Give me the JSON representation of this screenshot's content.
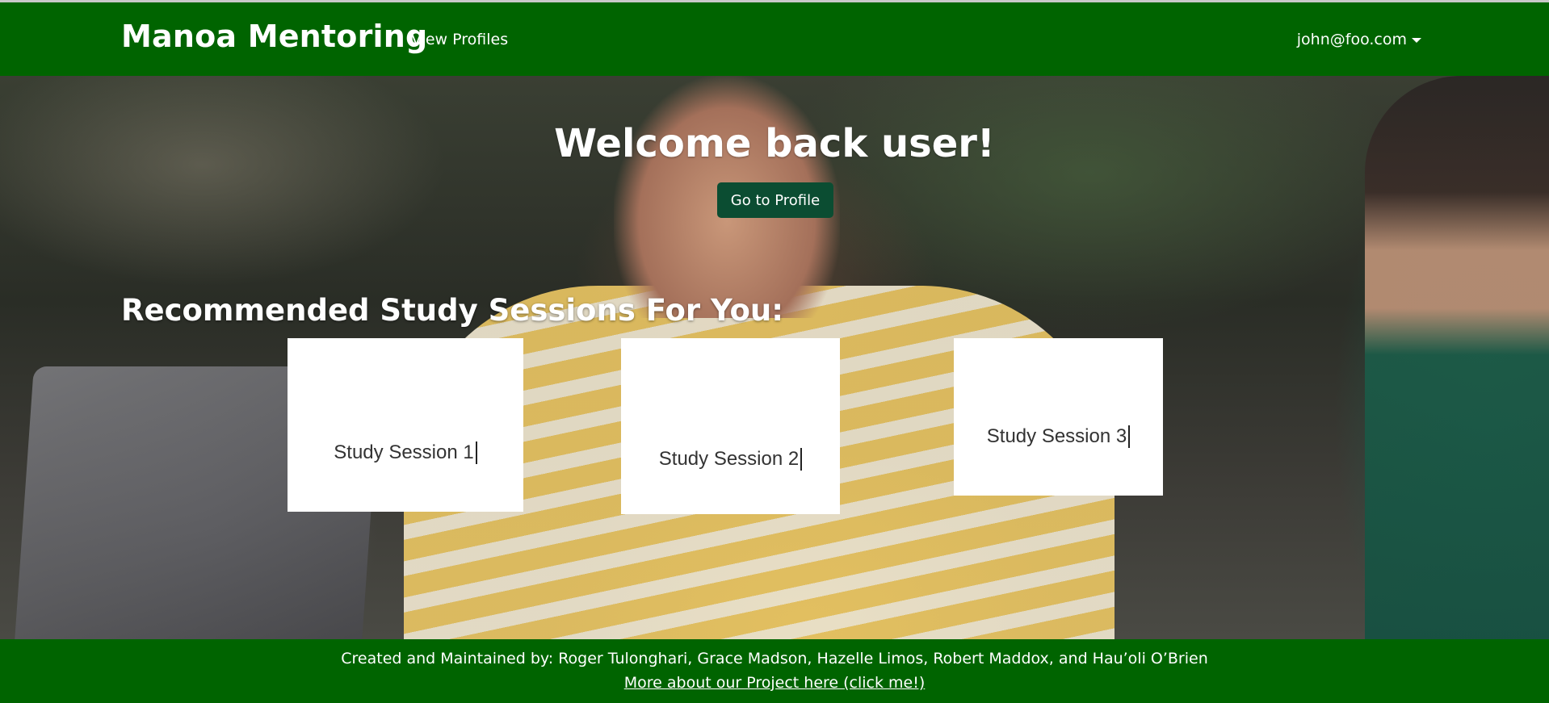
{
  "navbar": {
    "brand": "Manoa Mentoring",
    "links": [
      {
        "label": "View Profiles"
      }
    ],
    "user_menu": {
      "label": "john@foo.com"
    }
  },
  "hero": {
    "welcome": "Welcome back user!",
    "profile_button": "Go to Profile",
    "sessions_heading": "Recommended Study Sessions For You:",
    "sessions": [
      {
        "label": "Study Session 1"
      },
      {
        "label": "Study Session 2"
      },
      {
        "label": "Study Session 3"
      }
    ]
  },
  "footer": {
    "credits": "Created and Maintained by: Roger Tulonghari, Grace Madson, Hazelle Limos, Robert Maddox, and Hau’oli O’Brien",
    "link_text": "More about our Project here (click me!)"
  },
  "colors": {
    "navbar_bg": "#006400",
    "footer_bg": "#006400",
    "button_bg": "#0b4d32",
    "card_bg": "#ffffff"
  }
}
